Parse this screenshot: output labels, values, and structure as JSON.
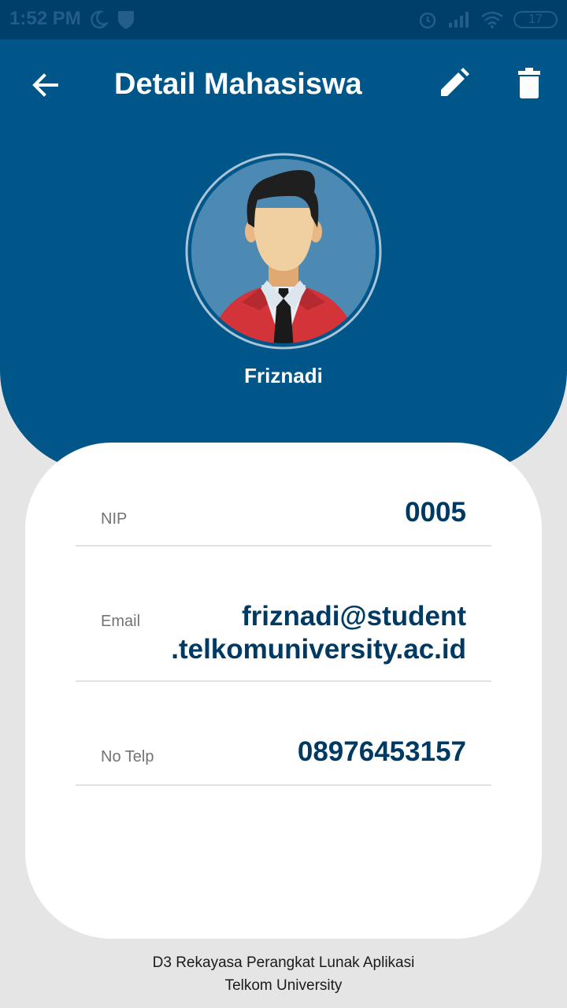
{
  "status_bar": {
    "time": "1:52 PM",
    "battery": "17"
  },
  "toolbar": {
    "title": "Detail Mahasiswa"
  },
  "profile": {
    "name": "Friznadi"
  },
  "details": {
    "nip_label": "NIP",
    "nip_value": "0005",
    "email_label": "Email",
    "email_line1": "friznadi@student",
    "email_line2": ".telkomuniversity.ac.id",
    "phone_label": "No Telp",
    "phone_value": "08976453157"
  },
  "footer": {
    "line1": "D3 Rekayasa Perangkat Lunak Aplikasi",
    "line2": "Telkom University"
  },
  "colors": {
    "primary": "#005589",
    "status_bar": "#013f6b",
    "value_text": "#003a63",
    "background": "#e6e5e6"
  }
}
